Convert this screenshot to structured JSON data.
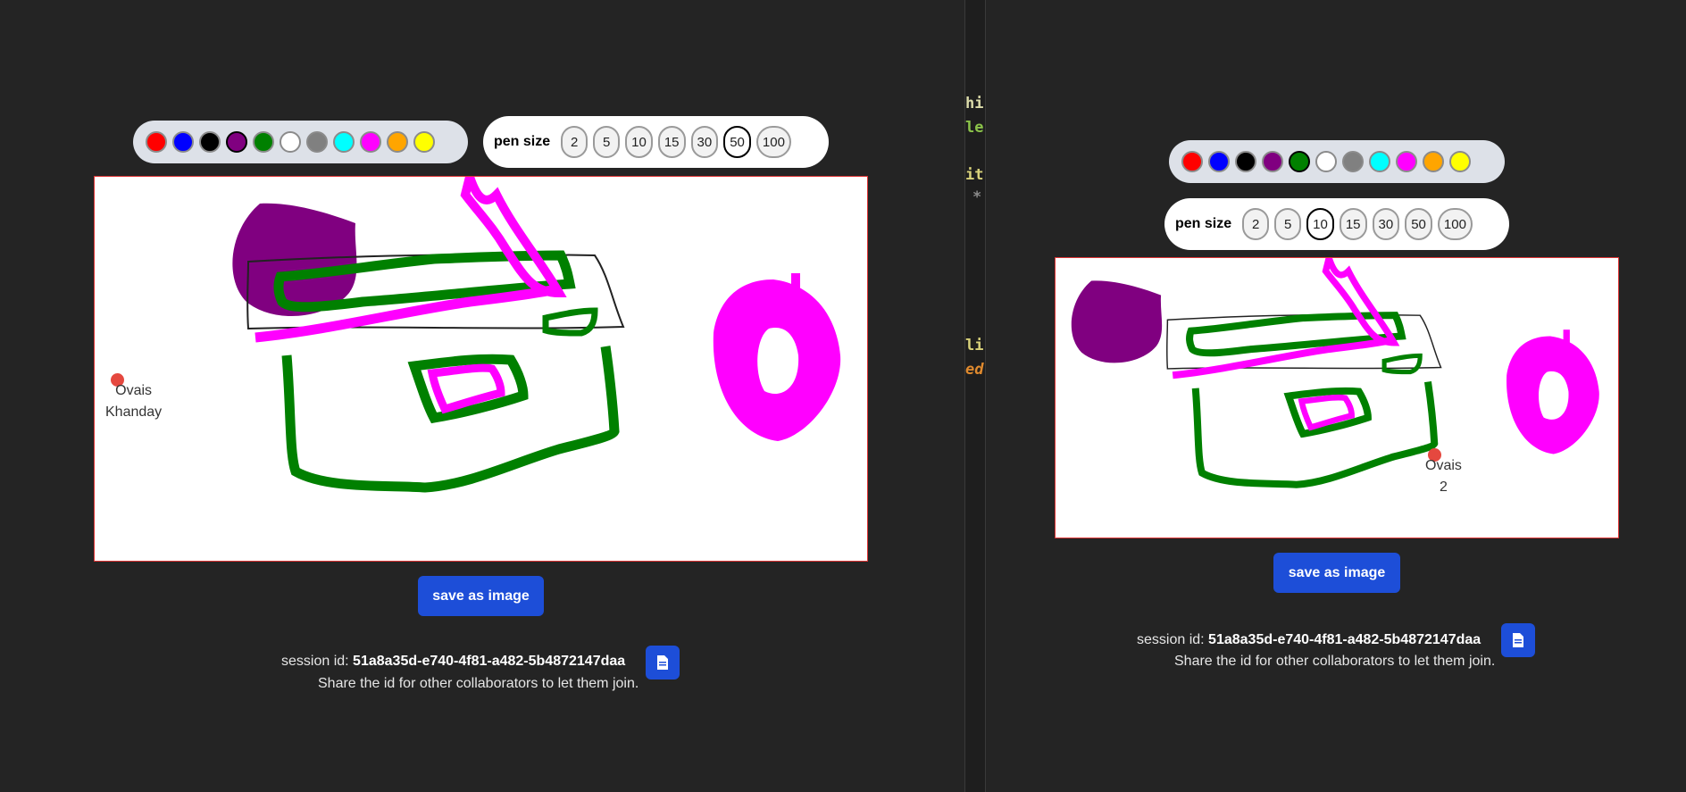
{
  "colors": {
    "palette": [
      "#ff0000",
      "#0000ff",
      "#000000",
      "#800080",
      "#008000",
      "#ffffff",
      "#808080",
      "#00ffff",
      "#ff00ff",
      "#ffa500",
      "#ffff00"
    ],
    "background": "#242424",
    "canvas": "#ffffff",
    "canvas_border": "#dd3333",
    "button": "#1d4ed8",
    "cursor": "#e5483f"
  },
  "left": {
    "pen_label": "pen size",
    "sizes": [
      "2",
      "5",
      "10",
      "15",
      "30",
      "50",
      "100"
    ],
    "selected_size": "50",
    "selected_color": "#800080",
    "cursor_name_line1": "Ovais",
    "cursor_name_line2": "Khanday",
    "save_label": "save as image",
    "session_prefix": "session id:",
    "session_id": "51a8a35d-e740-4f81-a482-5b4872147daa",
    "share_text": "Share the id for other collaborators to let them join.",
    "copy_icon": "document-icon"
  },
  "right": {
    "pen_label": "pen size",
    "sizes": [
      "2",
      "5",
      "10",
      "15",
      "30",
      "50",
      "100"
    ],
    "selected_size": "10",
    "selected_color": "#008000",
    "cursor_name_line1": "Ovais",
    "cursor_name_line2": "2",
    "save_label": "save as image",
    "session_prefix": "session id:",
    "session_id": "51a8a35d-e740-4f81-a482-5b4872147daa",
    "share_text": "Share the id for other collaborators to let them join.",
    "copy_icon": "document-icon"
  },
  "code_fragments": [
    "hi",
    "le",
    "it",
    "*",
    "li",
    "ed"
  ]
}
